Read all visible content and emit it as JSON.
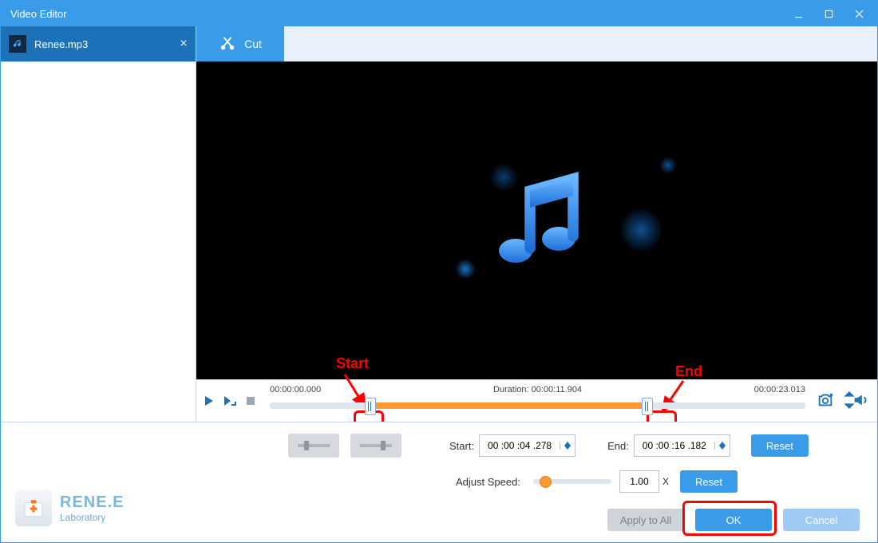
{
  "window": {
    "title": "Video Editor"
  },
  "file": {
    "name": "Renee.mp3"
  },
  "tab": {
    "cut": "Cut"
  },
  "annotations": {
    "start": "Start",
    "end": "End"
  },
  "timeline": {
    "start_time": "00:00:00.000",
    "duration_label": "Duration:",
    "duration_value": "00:00:11.904",
    "end_time": "00:00:23.013"
  },
  "fields": {
    "start_label": "Start:",
    "start_value": "00 :00 :04 .278",
    "end_label": "End:",
    "end_value": "00 :00 :16 .182",
    "reset": "Reset",
    "speed_label": "Adjust Speed:",
    "speed_value": "1.00",
    "x": "X"
  },
  "brand": {
    "line1": "RENE.E",
    "line2": "Laboratory"
  },
  "buttons": {
    "apply": "Apply to All",
    "ok": "OK",
    "cancel": "Cancel"
  }
}
